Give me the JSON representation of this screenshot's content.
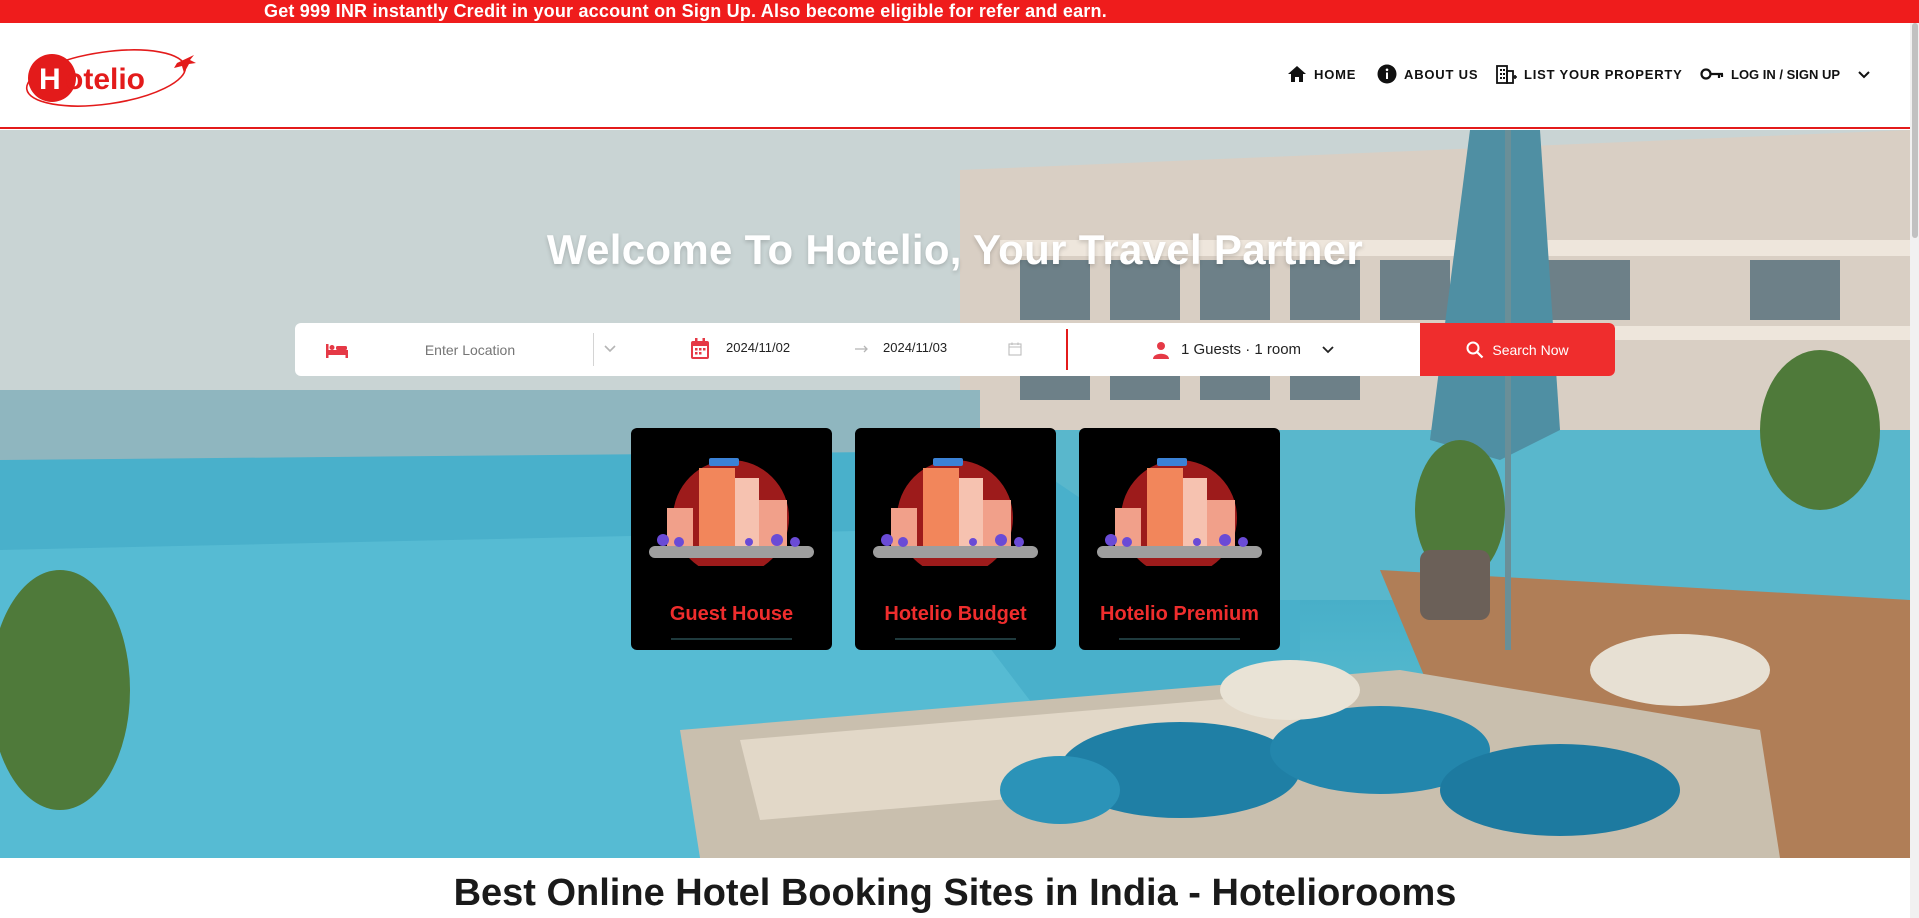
{
  "promo": {
    "text": "Get 999 INR instantly Credit in your account on Sign Up. Also become eligible for refer and earn."
  },
  "brand": {
    "logo_text": "Hotelio",
    "accent": "#ef1c1c"
  },
  "nav": {
    "items": [
      {
        "label": "HOME",
        "icon": "home-icon"
      },
      {
        "label": "ABOUT US",
        "icon": "info-icon"
      },
      {
        "label": "LIST YOUR PROPERTY",
        "icon": "building-icon"
      },
      {
        "label": "LOG IN / SIGN UP",
        "icon": "key-icon"
      }
    ]
  },
  "hero": {
    "title": "Welcome To Hotelio, Your Travel Partner"
  },
  "search": {
    "location_placeholder": "Enter Location",
    "checkin": "2024/11/02",
    "checkout": "2024/11/03",
    "guests": "1 Guests · 1 room",
    "button_label": "Search Now"
  },
  "categories": [
    {
      "label": "Guest House"
    },
    {
      "label": "Hotelio Budget"
    },
    {
      "label": "Hotelio Premium"
    }
  ],
  "section": {
    "title": "Best Online Hotel Booking Sites in India - Hoteliorooms"
  }
}
